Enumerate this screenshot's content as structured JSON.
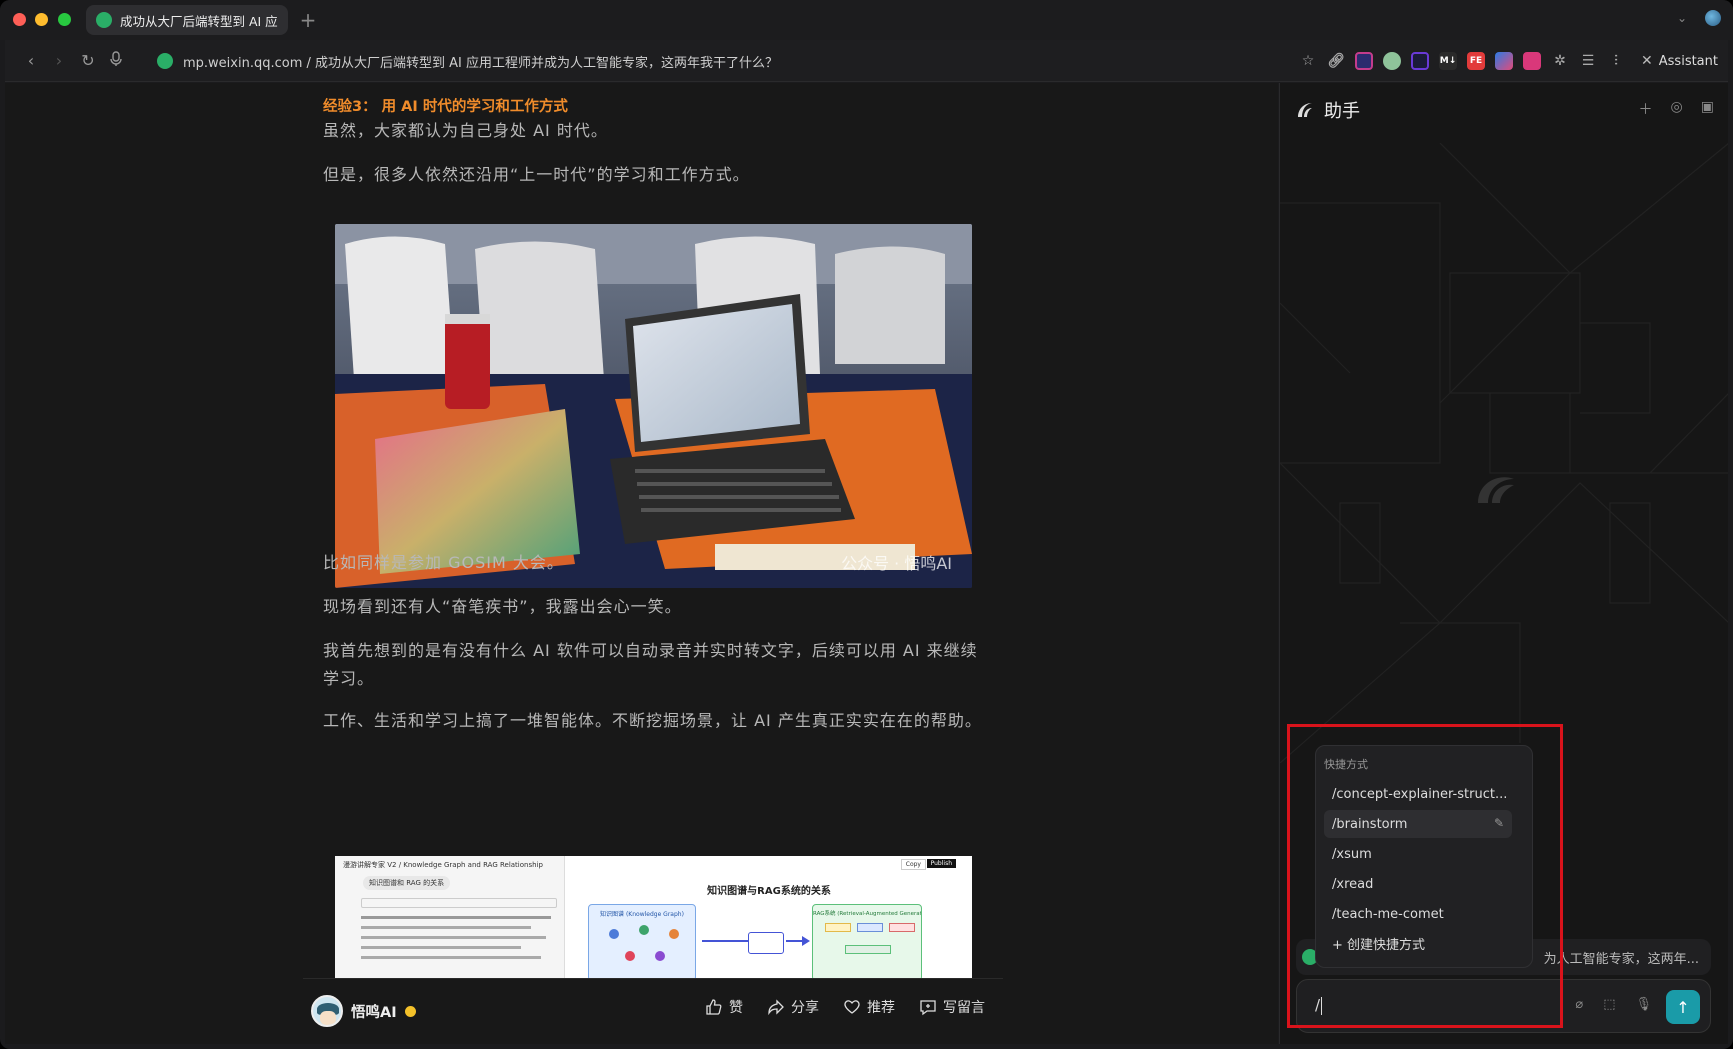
{
  "browser": {
    "tab_title": "成功从大厂后端转型到 AI 应用",
    "new_tab": "+",
    "address": "mp.weixin.qq.com / 成功从大厂后端转型到 AI 应用工程师并成为人工智能专家，这两年我干了什么？",
    "assistant_label": "Assistant",
    "extensions": [
      {
        "name": "fe-extension",
        "label": "FE",
        "color": "#e23b3b"
      },
      {
        "name": "markdown-extension",
        "label": "M↓",
        "color": "#2a2a2a"
      }
    ]
  },
  "article": {
    "section_title": "经验3： 用 AI 时代的学习和工作方式",
    "p1": "虽然，大家都认为自己身处 AI  时代。",
    "p2": "但是，很多人依然还沿用“上一时代”的学习和工作方式。",
    "watermark": "公众号 · 悟鸣AI",
    "p3": "比如同样是参加  GOSIM 大会。",
    "p4": "现场看到还有人“奋笔疾书”，我露出会心一笑。",
    "p5": "我首先想到的是有没有什么 AI  软件可以自动录音并实时转文字，后续可以用 AI 来继续学习。",
    "p6": "工作、生活和学习上搞了一堆智能体。不断挖掘场景，让 AI 产生真正实实在在的帮助。",
    "shot2": {
      "breadcrumb": "漫游讲解专家 V2 / Knowledge Graph and RAG Relationship",
      "chip": "知识图谱和 RAG 的关系",
      "diagram_title": "知识图谱与RAG系统的关系",
      "left_box": "知识图谱 (Knowledge Graph)",
      "right_box": "RAG系统 (Retrieval-Augmented Generation)",
      "copy": "Copy",
      "publish": "Publish"
    },
    "author": "悟鸣AI",
    "actions": {
      "like": "赞",
      "share": "分享",
      "recommend": "推荐",
      "comment": "写留言"
    }
  },
  "assistant": {
    "title": "助手",
    "context_chip": "为人工智能专家，这两年...",
    "input_value": "/",
    "popup": {
      "header": "快捷方式",
      "items": [
        "/concept-explainer-struct...",
        "/brainstorm",
        "/xsum",
        "/xread",
        "/teach-me-comet"
      ],
      "selected_index": 1,
      "create": "+ 创建快捷方式"
    }
  }
}
